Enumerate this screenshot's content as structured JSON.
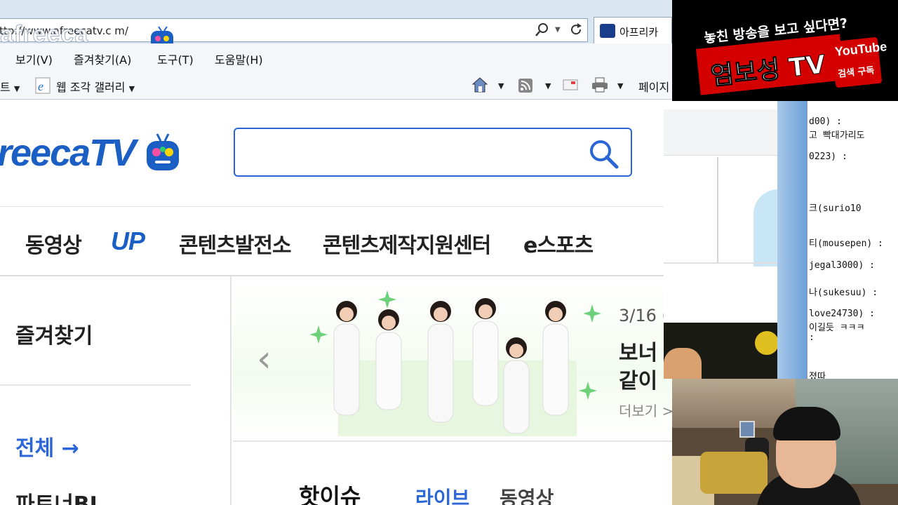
{
  "browser": {
    "url": "ttp://www.afreecatv.c  m/",
    "overlay_logo_text": "afreeca",
    "tab_title": "아프리카"
  },
  "menubar": {
    "view": "보기(V)",
    "favorites": "즐겨찾기(A)",
    "tools": "도구(T)",
    "help": "도움말(H)"
  },
  "commandbar": {
    "partial_left": "트",
    "web_slice_gallery": "웹 조각 갤러리",
    "page": "페이지"
  },
  "site": {
    "brand": "reecaTV",
    "search_placeholder": "",
    "nav": [
      "동영상",
      "UP",
      "콘텐츠발전소",
      "콘텐츠제작지원센터",
      "e스포츠"
    ],
    "left": {
      "favorites_title": "즐겨찾기",
      "all_link": "전체 →",
      "partner": "파트너BJ"
    },
    "banner": {
      "date": "3/16 (",
      "line1": "보너",
      "line2": "같이",
      "more": "더보기 >"
    },
    "hot_issue": {
      "title": "핫이슈",
      "tab_live": "라이브",
      "tab_vod": "동영상"
    }
  },
  "overlay": {
    "promo_sub": "놓친 방송을 보고 싶다면?",
    "promo_main": "염보성 TV",
    "youtube": "YouTube",
    "youtube_sub": "검색 구독"
  },
  "chat": [
    "d00) :",
    "고 빡대가리도",
    "0223) :",
    "",
    "크(surio10",
    "티(mousepen) :",
    "jegal3000) :",
    "나(sukesuu) :",
    "love24730) :",
    "이길듯 ㅋㅋㅋ",
    ":",
    "졌따"
  ],
  "colors": {
    "accent": "#2b66d6",
    "brand_blue": "#1b5fc4",
    "promo_red": "#d40000"
  }
}
